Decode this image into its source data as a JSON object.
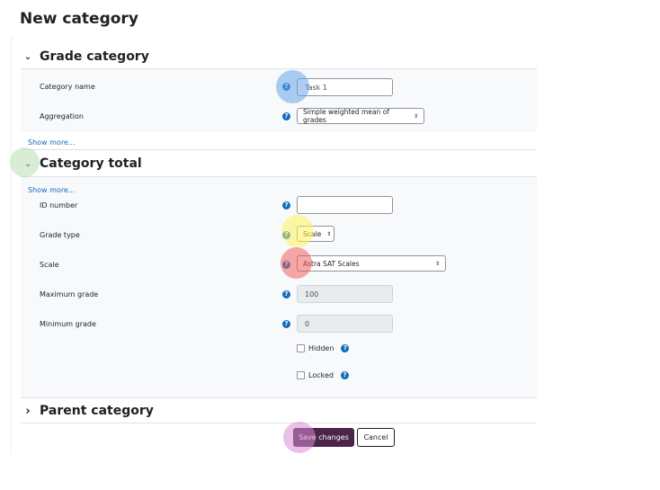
{
  "page": {
    "title": "New category"
  },
  "sections": {
    "grade_category": {
      "title": "Grade category",
      "expanded": true
    },
    "category_total": {
      "title": "Category total",
      "expanded": true
    },
    "parent_category": {
      "title": "Parent category",
      "expanded": false
    }
  },
  "fields": {
    "category_name": {
      "label": "Category name",
      "value": "Task 1"
    },
    "aggregation": {
      "label": "Aggregation",
      "value": "Simple weighted mean of grades"
    },
    "id_number": {
      "label": "ID number",
      "value": ""
    },
    "grade_type": {
      "label": "Grade type",
      "value": "Scale"
    },
    "scale": {
      "label": "Scale",
      "value": "Astra SAT Scales"
    },
    "maximum_grade": {
      "label": "Maximum grade",
      "value": "100"
    },
    "minimum_grade": {
      "label": "Minimum grade",
      "value": "0"
    },
    "hidden": {
      "label": "Hidden",
      "checked": false
    },
    "locked": {
      "label": "Locked",
      "checked": false
    }
  },
  "links": {
    "show_more": "Show more..."
  },
  "buttons": {
    "save": "Save changes",
    "cancel": "Cancel"
  },
  "icons": {
    "help": "?",
    "chevron_down": "⌄",
    "chevron_right": "›",
    "select_caret": "⇕"
  },
  "colors": {
    "help_icon": "#0f6cbf",
    "link": "#0f6cbf",
    "primary_button": "#4b2447",
    "highlight_blue": "#6aa6e8",
    "highlight_green": "#b8e0b0",
    "highlight_yellow": "#fff25c",
    "highlight_red": "#f06060",
    "highlight_purple": "#d98ad6"
  }
}
